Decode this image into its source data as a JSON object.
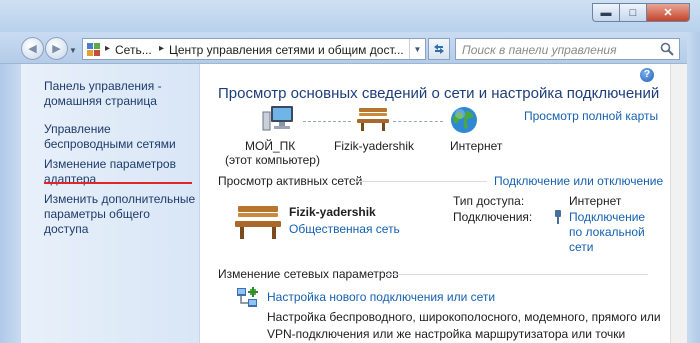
{
  "window": {
    "caption_buttons": [
      "minimize",
      "maximize",
      "close"
    ]
  },
  "nav": {
    "breadcrumb": [
      "Сеть...",
      "Центр управления сетями и общим дост..."
    ],
    "search_placeholder": "Поиск в панели управления"
  },
  "sidebar": {
    "items": [
      {
        "label": "Панель управления - домашняя страница"
      },
      {
        "label": "Управление беспроводными сетями"
      },
      {
        "label": "Изменение параметров адаптера"
      },
      {
        "label": "Изменить дополнительные параметры общего доступа"
      }
    ],
    "highlight_color": "#e0262b"
  },
  "main": {
    "title": "Просмотр основных сведений о сети и настройка подключений",
    "full_map_link": "Просмотр полной карты",
    "map": {
      "computer_name": "МОЙ_ПК",
      "computer_sub": "(этот компьютер)",
      "network_name": "Fizik-yadershik",
      "internet_label": "Интернет"
    },
    "active_networks": {
      "heading": "Просмотр активных сетей",
      "connect_link": "Подключение или отключение",
      "network_name": "Fizik-yadershik",
      "network_type": "Общественная сеть",
      "access_type_label": "Тип доступа:",
      "access_type_value": "Интернет",
      "connections_label": "Подключения:",
      "connections_value": "Подключение по локальной сети"
    },
    "change_settings": {
      "heading": "Изменение сетевых параметров",
      "new_connection_link": "Настройка нового подключения или сети",
      "new_connection_desc": "Настройка беспроводного, широкополосного, модемного, прямого или VPN-подключения или же настройка маршрутизатора или точки доступа."
    }
  },
  "colors": {
    "link": "#1560b0",
    "title": "#1e3e7a",
    "sidebar_bg": "#dfe9f7"
  },
  "icons": [
    "back-icon",
    "forward-icon",
    "control-panel-icon",
    "refresh-icon",
    "search-icon",
    "help-icon",
    "computer-icon",
    "bench-icon",
    "globe-icon",
    "network-setup-icon",
    "wired-connection-icon"
  ]
}
